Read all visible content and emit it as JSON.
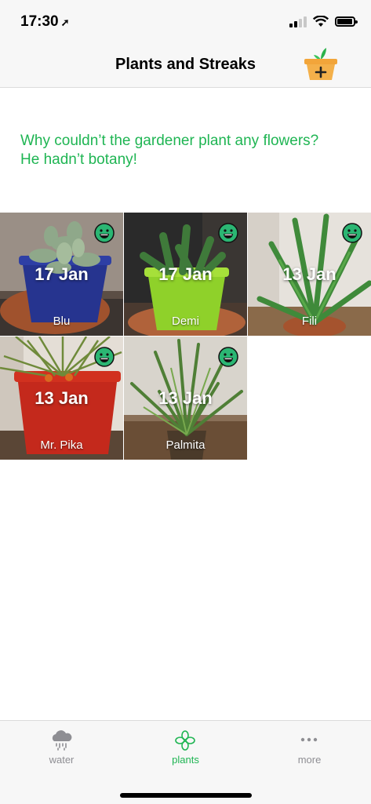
{
  "status_bar": {
    "time": "17:30"
  },
  "nav": {
    "title": "Plants and Streaks",
    "add_icon": "plant-pot-add-icon"
  },
  "joke": {
    "line1": "Why couldn’t the gardener plant any flowers?",
    "line2": "He hadn’t botany!",
    "color": "#1fb553"
  },
  "plants": [
    {
      "name": "Blu",
      "date": "17 Jan",
      "mood": "happy"
    },
    {
      "name": "Demi",
      "date": "17 Jan",
      "mood": "happy"
    },
    {
      "name": "Fili",
      "date": "13 Jan",
      "mood": "happy"
    },
    {
      "name": "Mr. Pika",
      "date": "13 Jan",
      "mood": "happy"
    },
    {
      "name": "Palmita",
      "date": "13 Jan",
      "mood": "happy"
    }
  ],
  "tabs": [
    {
      "label": "water",
      "icon": "rain-cloud-icon",
      "active": false
    },
    {
      "label": "plants",
      "icon": "flower-icon",
      "active": true
    },
    {
      "label": "more",
      "icon": "more-dots-icon",
      "active": false
    }
  ],
  "colors": {
    "accent": "#1fb553",
    "mood_face": "#2bb673"
  }
}
